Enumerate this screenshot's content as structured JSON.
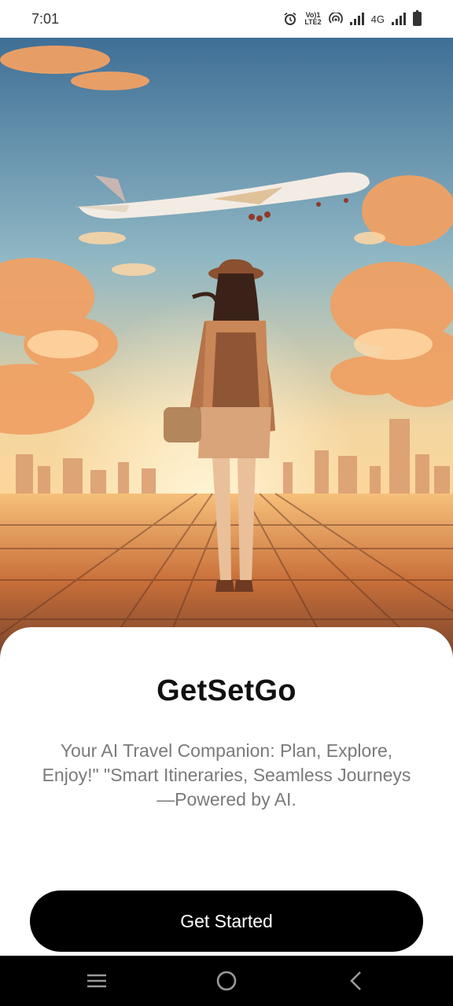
{
  "status_bar": {
    "time": "7:01",
    "volte_label_top": "Vo)1",
    "volte_label_bottom": "LTE2",
    "network_label": "4G",
    "icons": [
      "alarm-icon",
      "volte-icon",
      "hotspot-icon",
      "signal-icon",
      "signal-icon",
      "battery-icon"
    ]
  },
  "hero": {
    "image": "illustration of a traveller with backpack and hat watching an airplane over a sunset city"
  },
  "app": {
    "title": "GetSetGo",
    "tagline": "Your AI Travel Companion: Plan, Explore, Enjoy!\" \"Smart Itineraries, Seamless Journeys—Powered by AI.",
    "cta_label": "Get Started"
  },
  "nav_bar": {
    "icons": [
      "menu-icon",
      "home-icon",
      "back-icon"
    ]
  },
  "colors": {
    "cta_background": "#000000",
    "cta_text": "#ffffff",
    "title": "#111111",
    "tagline": "#7a7a7a",
    "sky_top": "#3f6f96",
    "sky_horizon": "#ffd79a"
  }
}
